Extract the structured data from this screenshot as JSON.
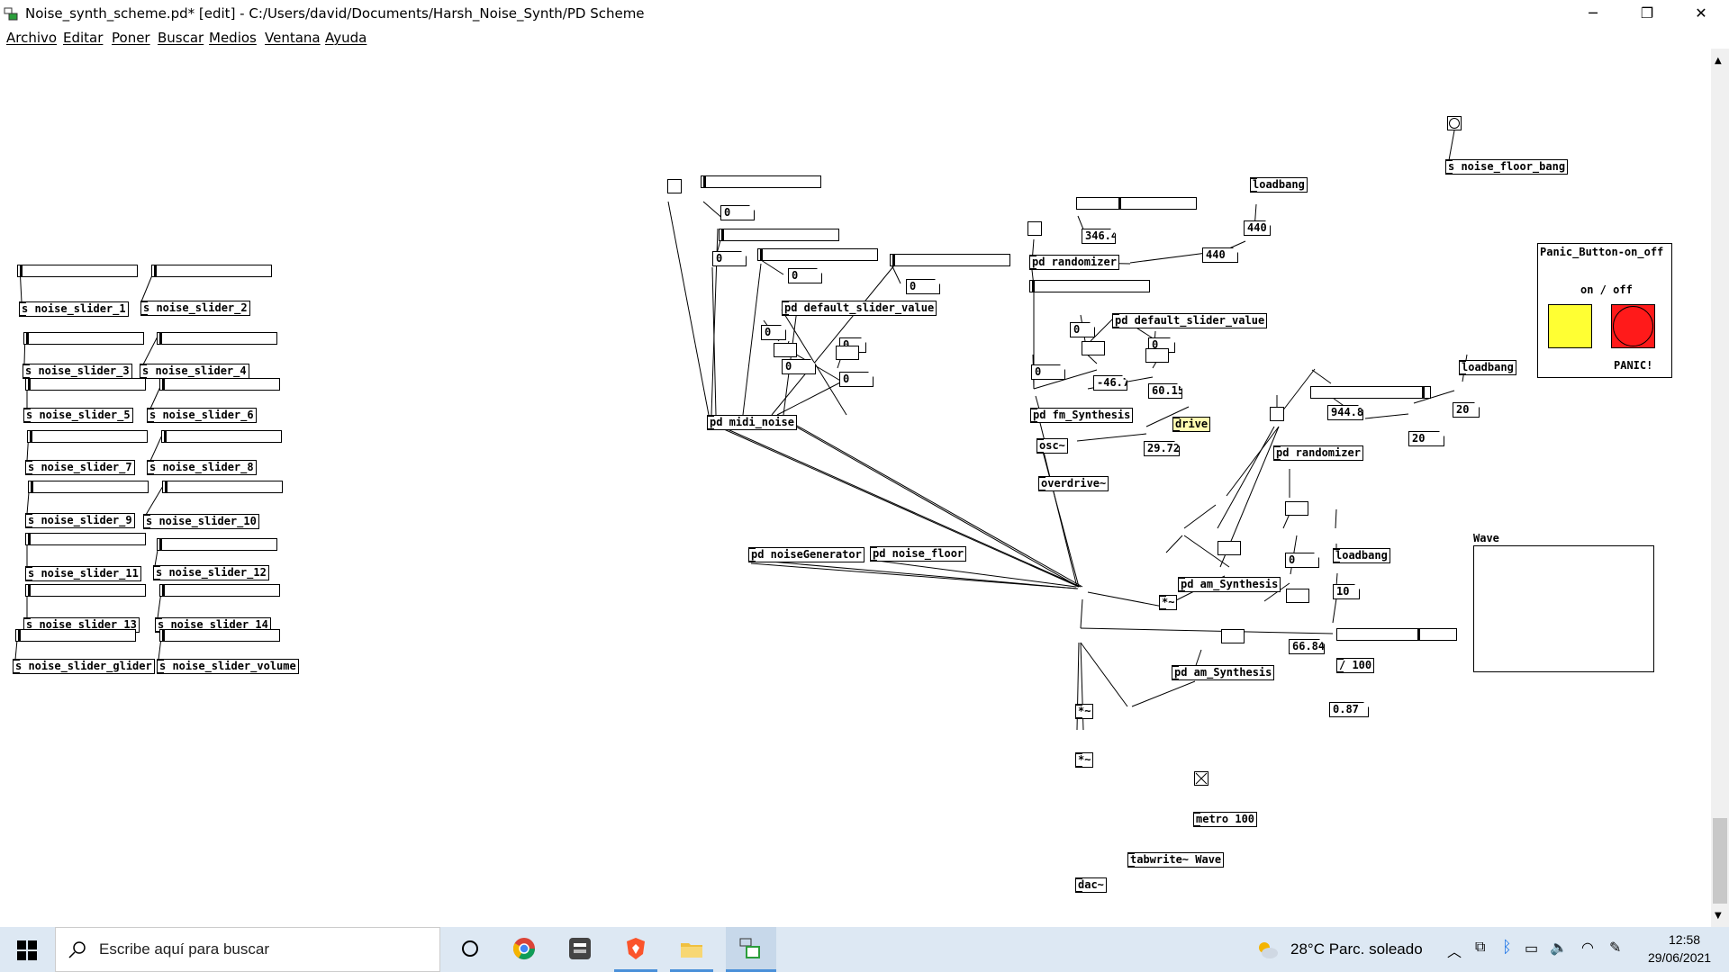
{
  "window": {
    "title": "Noise_synth_scheme.pd* [edit] - C:/Users/david/Documents/Harsh_Noise_Synth/PD Scheme",
    "minimize_glyph": "─",
    "maximize_glyph": "❐",
    "close_glyph": "✕"
  },
  "menu": [
    "Archivo",
    "Editar",
    "Poner",
    "Buscar",
    "Medios",
    "Ventana",
    "Ayuda"
  ],
  "left_sends": [
    "s noise_slider_1",
    "s noise_slider_2",
    "s noise_slider_3",
    "s noise_slider_4",
    "s noise_slider_5",
    "s noise_slider_6",
    "s noise_slider_7",
    "s noise_slider_8",
    "s noise_slider_9",
    "s noise_slider_10",
    "s noise_slider_11",
    "s noise_slider_12",
    "s noise_slider_13",
    "s noise_slider_14",
    "s noise_slider_glider",
    "s noise_slider_volume"
  ],
  "objects": {
    "noise_floor_bang": "s noise_floor_bang",
    "loadbang": "loadbang",
    "pd_randomizer": "pd randomizer",
    "pd_default_slider_value": "pd default_slider_value",
    "pd_fm_synthesis": "pd fm_Synthesis",
    "osc": "osc~",
    "overdrive": "overdrive~",
    "pd_midi_noise": "pd midi_noise",
    "pd_noise_generator": "pd noiseGenerator",
    "pd_noise_floor": "pd noise_floor",
    "pd_am_synthesis": "pd am_Synthesis",
    "mult": "*~",
    "metro": "metro 100",
    "tabwrite": "tabwrite~ Wave",
    "dac": "dac~",
    "div100": "/ 100",
    "drive": "drive"
  },
  "numbers": {
    "n346": "346.4",
    "n440": "440",
    "n_zero": "0",
    "n_neg467": "-46.7",
    "n6015": "60.15",
    "n2972": "29.72",
    "n9448": "944.8",
    "n20": "20",
    "n10": "10",
    "n6684": "66.84",
    "n087": "0.87"
  },
  "panic_panel": {
    "title": "Panic_Button-on_off",
    "on_off": "on / off",
    "panic": "PANIC!",
    "colors": {
      "on": "#ffff33",
      "panic": "#ff1a1a"
    }
  },
  "wave_array": {
    "name": "Wave"
  },
  "taskbar": {
    "search_placeholder": "Escribe aquí para buscar",
    "weather": "28°C  Parc. soleado",
    "time": "12:58",
    "date": "29/06/2021"
  }
}
